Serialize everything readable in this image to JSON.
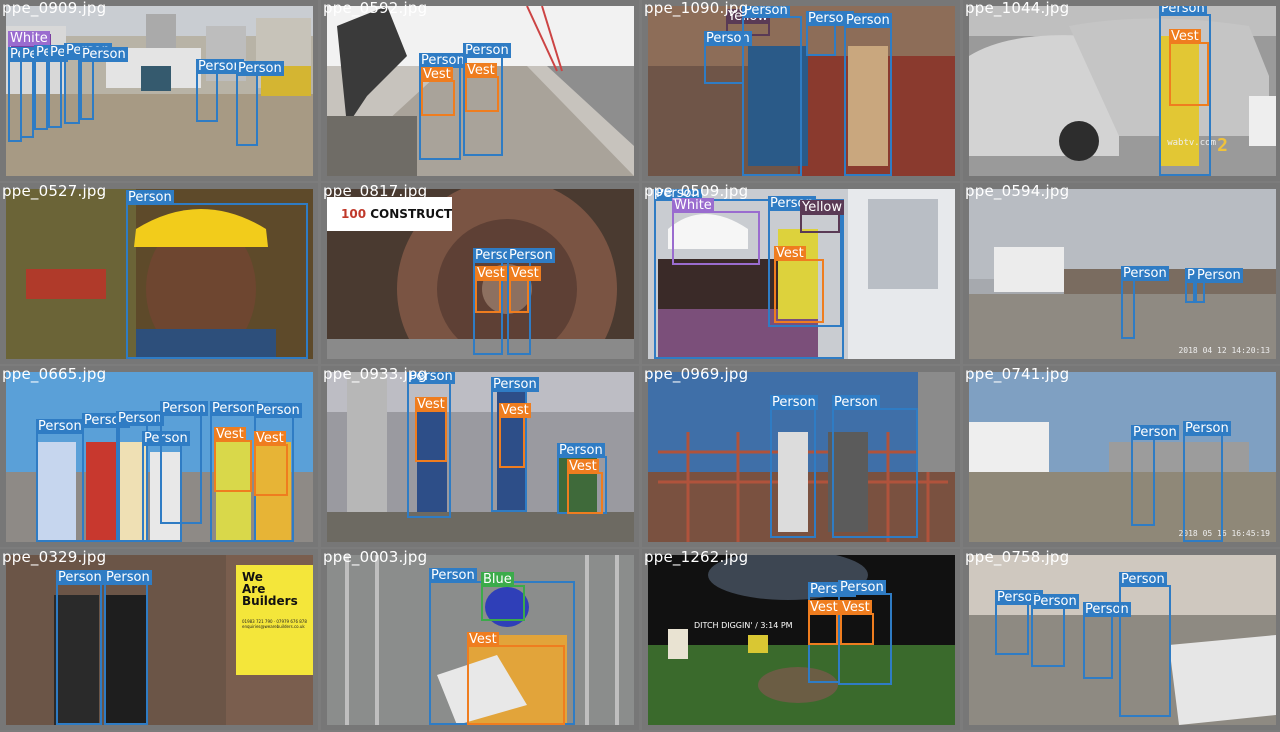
{
  "colors": {
    "person": "#2f7cc4",
    "vest": "#ef7d1f",
    "white": "#9a6ccf",
    "yellow": "#5a3a55",
    "blue": "#3bab4a"
  },
  "tiles": [
    {
      "file": "ppe_0909.jpg",
      "sign": "茶水间",
      "extra": "White"
    },
    {
      "file": "ppe_0592.jpg"
    },
    {
      "file": "ppe_1090.jpg",
      "extra": "Yellow"
    },
    {
      "file": "ppe_1044.jpg",
      "watermark": "wabtv.com",
      "channel": "2"
    },
    {
      "file": "ppe_0527.jpg"
    },
    {
      "file": "ppe_0817.jpg",
      "logo": "CONSTRUCT",
      "logo_mark": "100"
    },
    {
      "file": "ppe_0509.jpg",
      "white_label": "White",
      "yellow_label": "Yellow"
    },
    {
      "file": "ppe_0594.jpg",
      "timestamp": "2018 04 12 14:20:13"
    },
    {
      "file": "ppe_0665.jpg"
    },
    {
      "file": "ppe_0933.jpg"
    },
    {
      "file": "ppe_0969.jpg"
    },
    {
      "file": "ppe_0741.jpg",
      "timestamp": "2018 05 16 16:45:19"
    },
    {
      "file": "ppe_0329.jpg",
      "sign_title": "We Are Builders",
      "sign_phone": "01983 721 790 · 07979 676 878",
      "sign_email": "enquiries@wearebuilders.co.uk",
      "sign_url": "www.wearebuilders.co.uk"
    },
    {
      "file": "ppe_0003.jpg",
      "blue_label": "Blue"
    },
    {
      "file": "ppe_1262.jpg",
      "caption": "DITCH DIGGIN' / 3:14 PM"
    },
    {
      "file": "ppe_0758.jpg"
    }
  ],
  "labels": {
    "person": "Person",
    "vest": "Vest"
  }
}
